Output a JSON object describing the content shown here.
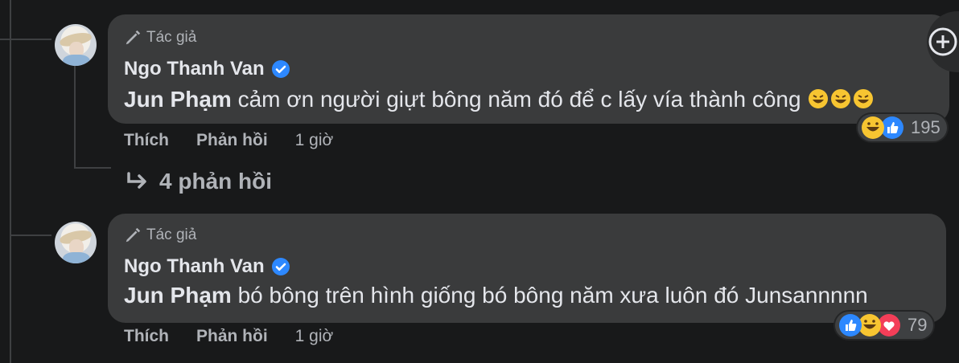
{
  "comments": [
    {
      "author_tag": "Tác giả",
      "name": "Ngo Thanh Van",
      "mention": "Jun Phạm",
      "text": " cảm ơn người giựt bông năm đó để c lấy vía thành công",
      "emojis": [
        "rofl-face",
        "rofl-face",
        "rofl-face"
      ],
      "actions": {
        "like": "Thích",
        "reply": "Phản hồi",
        "time": "1 giờ"
      },
      "reactions": {
        "icons": [
          "laugh",
          "like"
        ],
        "count": "195"
      },
      "replies_link": "4 phản hồi"
    },
    {
      "author_tag": "Tác giả",
      "name": "Ngo Thanh Van",
      "mention": "Jun Phạm",
      "text": " bó bông trên hình giống bó bông năm xưa luôn đó Junsannnnn",
      "actions": {
        "like": "Thích",
        "reply": "Phản hồi",
        "time": "1 giờ"
      },
      "reactions": {
        "icons": [
          "like",
          "laugh",
          "love"
        ],
        "count": "79"
      }
    }
  ],
  "colors": {
    "background": "#18191a",
    "bubble": "#3a3b3c",
    "text": "#e4e6eb",
    "secondary": "#b0b3b8",
    "verified": "#2d88ff"
  }
}
